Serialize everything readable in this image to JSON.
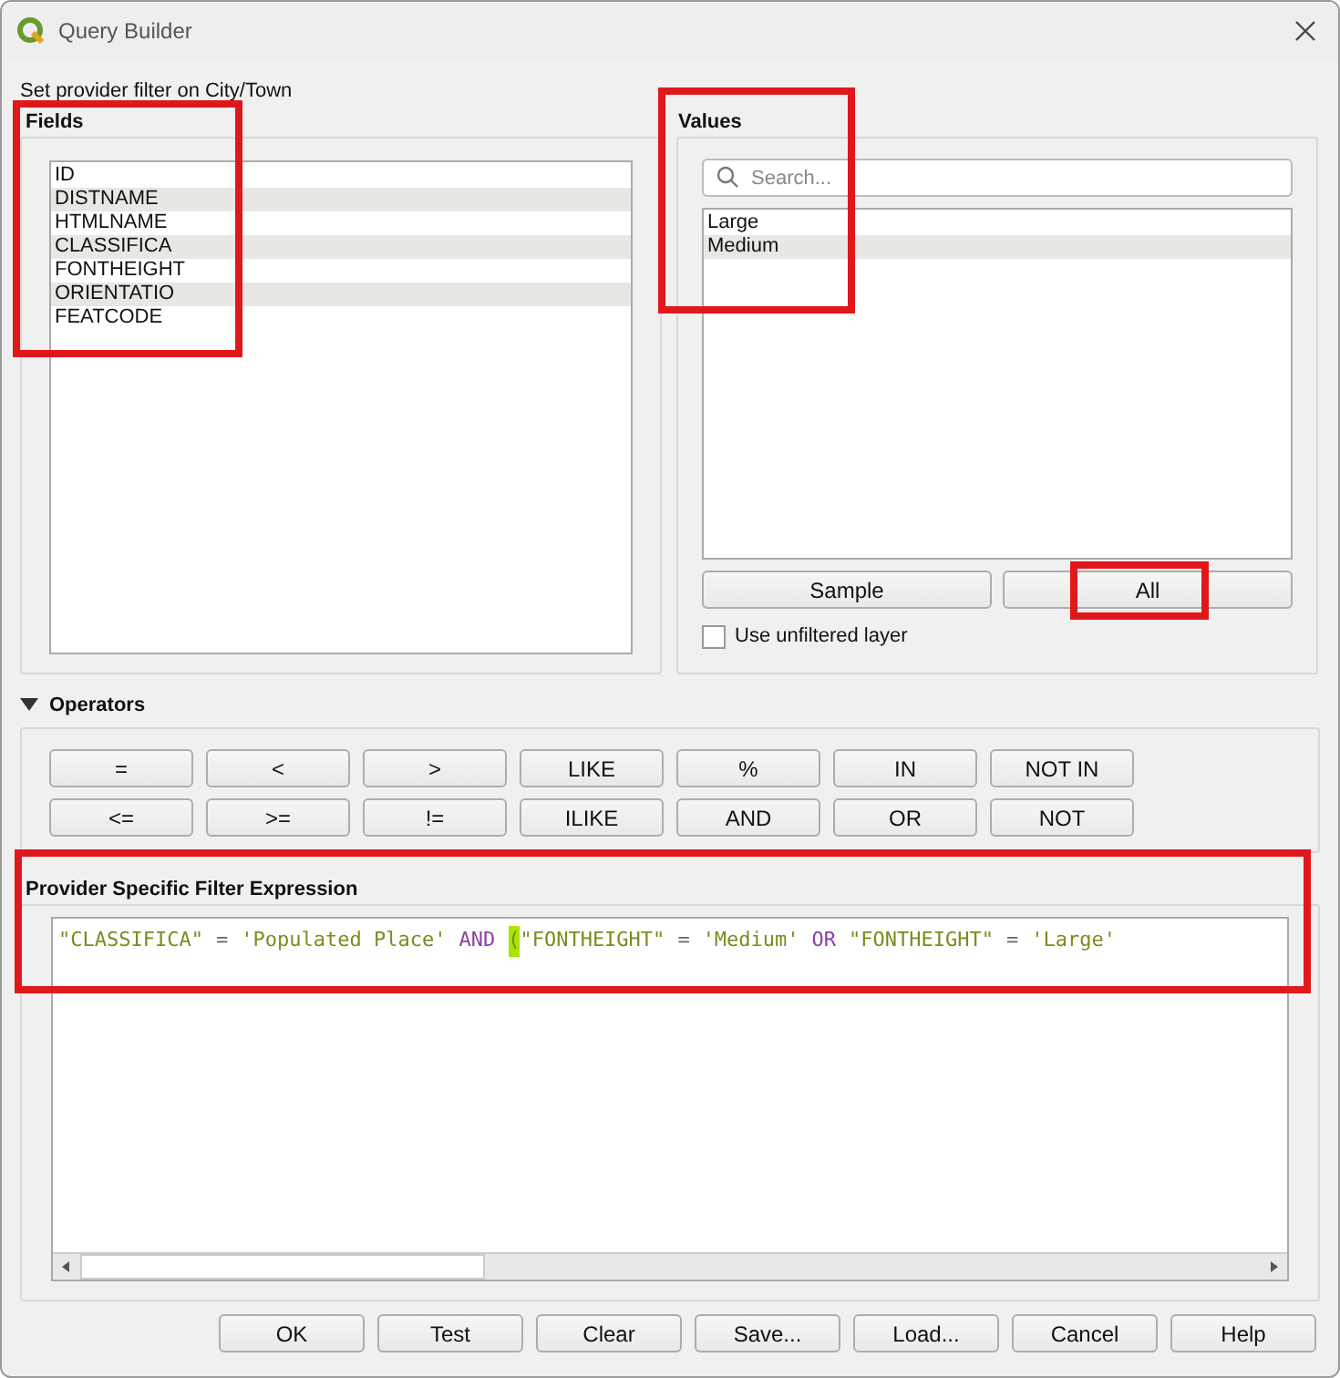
{
  "window": {
    "title": "Query Builder"
  },
  "subtitle": "Set provider filter on City/Town",
  "fields": {
    "title": "Fields",
    "highlighted": true,
    "items": [
      {
        "label": "ID",
        "selected": false
      },
      {
        "label": "DISTNAME",
        "selected": false
      },
      {
        "label": "HTMLNAME",
        "selected": false
      },
      {
        "label": "CLASSIFICA",
        "selected": false
      },
      {
        "label": "FONTHEIGHT",
        "selected": false
      },
      {
        "label": "ORIENTATIO",
        "selected": false
      },
      {
        "label": "FEATCODE",
        "selected": false
      }
    ]
  },
  "values": {
    "title": "Values",
    "highlighted": true,
    "search": {
      "placeholder": "Search..."
    },
    "items": [
      {
        "label": "Large",
        "selected": false
      },
      {
        "label": "Medium",
        "selected": false
      }
    ],
    "buttons": [
      {
        "label": "Sample",
        "highlighted": false
      },
      {
        "label": "All",
        "highlighted": true
      }
    ],
    "unfiltered": {
      "label": "Use unfiltered layer",
      "checked": false
    }
  },
  "operators": {
    "title": "Operators",
    "expanded": true,
    "rows": [
      [
        "=",
        "<",
        ">",
        "LIKE",
        "%",
        "IN",
        "NOT IN"
      ],
      [
        "<=",
        ">=",
        "!=",
        "ILIKE",
        "AND",
        "OR",
        "NOT"
      ]
    ]
  },
  "expression": {
    "title": "Provider Specific Filter Expression",
    "highlighted": true,
    "tokens": [
      {
        "text": "\"CLASSIFICA\"",
        "kind": "field"
      },
      {
        "text": "=",
        "kind": "operator"
      },
      {
        "text": "'Populated Place'",
        "kind": "string"
      },
      {
        "text": "AND",
        "kind": "keyword"
      },
      {
        "text": "(",
        "kind": "bracket"
      },
      {
        "text": "\"FONTHEIGHT\"",
        "kind": "field"
      },
      {
        "text": "=",
        "kind": "operator"
      },
      {
        "text": "'Medium'",
        "kind": "string"
      },
      {
        "text": "OR",
        "kind": "keyword"
      },
      {
        "text": "\"FONTHEIGHT\"",
        "kind": "field"
      },
      {
        "text": "=",
        "kind": "operator"
      },
      {
        "text": "'Large'",
        "kind": "string"
      }
    ]
  },
  "buttons": [
    "OK",
    "Test",
    "Clear",
    "Save...",
    "Load...",
    "Cancel",
    "Help"
  ]
}
